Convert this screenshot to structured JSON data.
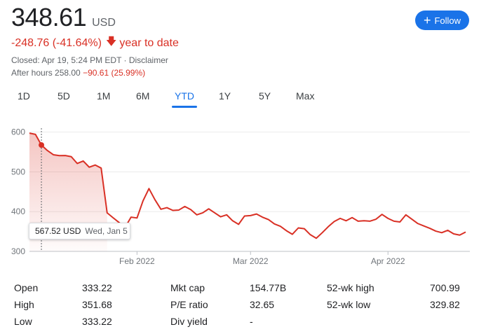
{
  "quote": {
    "price": "348.61",
    "currency": "USD",
    "change": "-248.76 (-41.64%)",
    "change_period": "year to date",
    "closed_info": "Closed: Apr 19, 5:24 PM EDT · Disclaimer",
    "after_hours_label": "After hours 258.00",
    "after_hours_change": "−90.61 (25.99%)"
  },
  "follow_button": {
    "label": "Follow",
    "icon": "plus-icon",
    "color": "#1a73e8"
  },
  "tabs": [
    {
      "label": "1D"
    },
    {
      "label": "5D"
    },
    {
      "label": "1M"
    },
    {
      "label": "6M"
    },
    {
      "label": "YTD",
      "active": true
    },
    {
      "label": "1Y"
    },
    {
      "label": "5Y"
    },
    {
      "label": "Max"
    }
  ],
  "tooltip": {
    "value": "567.52 USD",
    "date": "Wed, Jan 5"
  },
  "chart_data": {
    "type": "area",
    "line_color": "#d93025",
    "ylim": [
      300,
      610
    ],
    "yticks": [
      300,
      400,
      500,
      600
    ],
    "ytick_labels": [
      "300",
      "400",
      "500",
      "600"
    ],
    "xticks": [
      {
        "label": "Feb 2022",
        "index": 18
      },
      {
        "label": "Mar 2022",
        "index": 37
      },
      {
        "label": "Apr 2022",
        "index": 60
      }
    ],
    "grid": true,
    "hover_index": 2,
    "values": [
      597.4,
      594.4,
      567.5,
      553.7,
      543.1,
      540.8,
      541.1,
      538.2,
      521.1,
      527.3,
      511.8,
      517.3,
      509.5,
      396.9,
      384.6,
      372.5,
      360.0,
      386.0,
      384.0,
      427.0,
      458.0,
      430.0,
      406.0,
      410.0,
      403.0,
      404.0,
      413.0,
      405.0,
      392.0,
      397.0,
      407.0,
      397.0,
      387.0,
      392.0,
      377.0,
      368.0,
      389.0,
      390.0,
      394.0,
      386.0,
      380.0,
      369.0,
      363.0,
      352.0,
      343.0,
      359.0,
      357.0,
      342.0,
      333.0,
      347.0,
      362.0,
      375.0,
      383.0,
      377.0,
      385.0,
      376.0,
      377.0,
      376.0,
      381.0,
      393.0,
      383.0,
      376.0,
      374.0,
      392.0,
      381.0,
      370.0,
      364.0,
      358.0,
      351.0,
      347.0,
      353.0,
      344.0,
      341.0,
      348.6
    ]
  },
  "stats": [
    {
      "label": "Open",
      "value": "333.22"
    },
    {
      "label": "High",
      "value": "351.68"
    },
    {
      "label": "Low",
      "value": "333.22"
    },
    {
      "label": "Mkt cap",
      "value": "154.77B"
    },
    {
      "label": "P/E ratio",
      "value": "32.65"
    },
    {
      "label": "Div yield",
      "value": "-"
    },
    {
      "label": "52-wk high",
      "value": "700.99"
    },
    {
      "label": "52-wk low",
      "value": "329.82"
    }
  ]
}
